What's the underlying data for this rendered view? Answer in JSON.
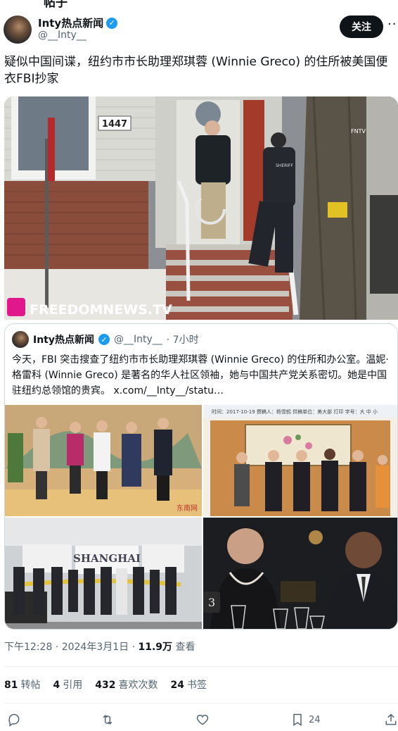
{
  "top_cut_text": "帖子",
  "author": {
    "name": "Inty热点新闻",
    "handle": "@__Inty__",
    "follow_label": "关注",
    "more_label": "···"
  },
  "post": {
    "text": "疑似中国间谍，纽约市市长助理郑琪蓉 (Winnie Greco) 的住所被美国便衣FBI抄家",
    "image": {
      "house_number": "1447",
      "watermark": "FREEDOMNEWS.TV",
      "corner_tag": "FNTV",
      "vest_text": "SHERIFF"
    }
  },
  "quote": {
    "name": "Inty热点新闻",
    "handle": "@__Inty__",
    "time": "· 7小时",
    "text": "今天，FBI 突击搜查了纽约市市长助理郑琪蓉 (Winnie Greco) 的住所和办公室。温妮·格雷科 (Winnie Greco) 是著名的华人社区领袖，她与中国共产党关系密切。她是中国驻纽约总领馆的贵宾。 x.com/__Inty__/statu…",
    "images": {
      "tile2_header": "时间：2017-10-19  撰稿人：杨雪鹤  供稿单位：美大部  打印  字号：大 中 小",
      "tile3_banner": "SHANGHAI",
      "tile1_logo": "东南网"
    }
  },
  "meta": {
    "time": "下午12:28 · 2024年3月1日 · ",
    "views": "11.9万",
    "views_label": " 查看"
  },
  "stats": [
    {
      "count": "81",
      "label": "转帖"
    },
    {
      "count": "4",
      "label": "引用"
    },
    {
      "count": "432",
      "label": "喜欢次数"
    },
    {
      "count": "24",
      "label": "书签"
    }
  ],
  "actions": {
    "bookmark_count": "24"
  }
}
